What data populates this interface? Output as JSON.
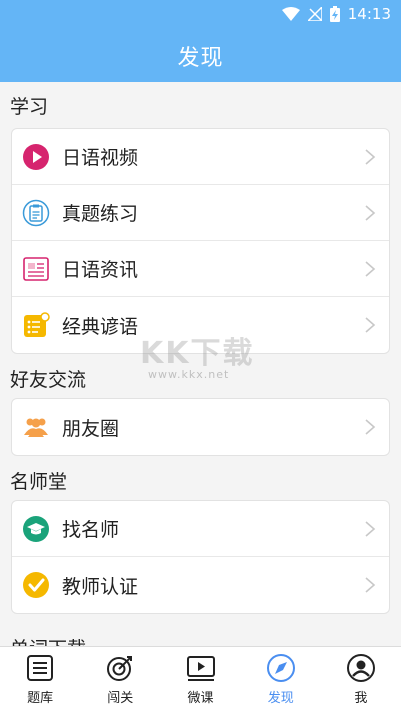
{
  "status_bar": {
    "time": "14:13"
  },
  "header": {
    "title": "发现"
  },
  "sections": [
    {
      "title": "学习",
      "items": [
        {
          "label": "日语视频",
          "icon": "play-circle-icon"
        },
        {
          "label": "真题练习",
          "icon": "clipboard-icon"
        },
        {
          "label": "日语资讯",
          "icon": "newspaper-icon"
        },
        {
          "label": "经典谚语",
          "icon": "notes-icon"
        }
      ]
    },
    {
      "title": "好友交流",
      "items": [
        {
          "label": "朋友圈",
          "icon": "people-icon"
        }
      ]
    },
    {
      "title": "名师堂",
      "items": [
        {
          "label": "找名师",
          "icon": "graduation-cap-icon"
        },
        {
          "label": "教师认证",
          "icon": "verified-check-icon"
        }
      ]
    },
    {
      "title": "单词下载",
      "items": []
    }
  ],
  "watermark": {
    "big": "KK下载",
    "small": "www.kkx.net"
  },
  "tabbar": {
    "items": [
      {
        "label": "题库",
        "icon": "list-icon"
      },
      {
        "label": "闯关",
        "icon": "target-icon"
      },
      {
        "label": "微课",
        "icon": "video-icon"
      },
      {
        "label": "发现",
        "icon": "compass-icon"
      },
      {
        "label": "我",
        "icon": "user-icon"
      }
    ],
    "active_index": 3
  },
  "colors": {
    "header": "#64b5f6",
    "accent": "#4a8ef0",
    "video_icon": "#d6246e",
    "check_icon": "#f5b800",
    "cap_icon": "#1aa37a",
    "people_icon": "#f5a04a"
  }
}
